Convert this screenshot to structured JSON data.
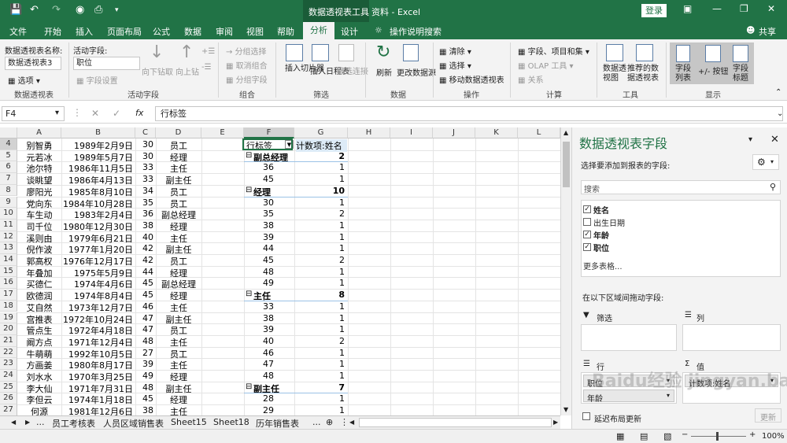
{
  "title_bar": {
    "context_title": "数据透视表工具",
    "doc_title": "资料 - Excel",
    "login": "登录"
  },
  "tabs": [
    "文件",
    "开始",
    "插入",
    "页面布局",
    "公式",
    "数据",
    "审阅",
    "视图",
    "帮助",
    "分析",
    "设计"
  ],
  "tell_me": "操作说明搜索",
  "share": "共享",
  "ribbon": {
    "pt_name_label": "数据透视表名称:",
    "pt_name_value": "数据透视表3",
    "options": "选项",
    "active_field_label": "活动字段:",
    "active_field_value": "职位",
    "field_settings": "字段设置",
    "drill_down": "向下钻取",
    "drill_up": "向上钻",
    "group_sel": "分组选择",
    "ungroup": "取消组合",
    "group_field": "分组字段",
    "insert_slicer": "插入切片器",
    "insert_timeline": "插入日程表",
    "filter_conn": "筛选连接",
    "refresh": "刷新",
    "change_source": "更改数据源",
    "clear": "清除",
    "select": "选择",
    "move_pt": "移动数据透视表",
    "fields_items": "字段、项目和集",
    "olap": "OLAP 工具",
    "relations": "关系",
    "pivot_chart": "数据透视图",
    "recommended": "推荐的数据透视表",
    "field_list": "字段列表",
    "buttons": "+/- 按钮",
    "headers": "字段标题",
    "groups": [
      "数据透视表",
      "活动字段",
      "组合",
      "筛选",
      "数据",
      "操作",
      "计算",
      "工具",
      "显示"
    ]
  },
  "formula_bar": {
    "name_box": "F4",
    "content": "行标签"
  },
  "columns": [
    "A",
    "B",
    "C",
    "D",
    "E",
    "F",
    "G",
    "H",
    "I",
    "J",
    "K",
    "L"
  ],
  "rows": [
    {
      "n": "4",
      "a": "别智勇",
      "b": "1989年2月9日",
      "c": "30",
      "d": "员工",
      "f": "行标签",
      "g": "计数项:姓名",
      "kind": "header"
    },
    {
      "n": "5",
      "a": "元若冰",
      "b": "1989年5月7日",
      "c": "30",
      "d": "经理",
      "f": "副总经理",
      "g": "2",
      "kind": "group"
    },
    {
      "n": "6",
      "a": "池尔特",
      "b": "1986年11月5日",
      "c": "33",
      "d": "主任",
      "f": "36",
      "g": "1",
      "kind": "item"
    },
    {
      "n": "7",
      "a": "谈眺望",
      "b": "1986年4月13日",
      "c": "33",
      "d": "副主任",
      "f": "45",
      "g": "1",
      "kind": "item"
    },
    {
      "n": "8",
      "a": "廖阳光",
      "b": "1985年8月10日",
      "c": "34",
      "d": "员工",
      "f": "经理",
      "g": "10",
      "kind": "group"
    },
    {
      "n": "9",
      "a": "党向东",
      "b": "1984年10月28日",
      "c": "35",
      "d": "员工",
      "f": "30",
      "g": "1",
      "kind": "item"
    },
    {
      "n": "10",
      "a": "车生动",
      "b": "1983年2月4日",
      "c": "36",
      "d": "副总经理",
      "f": "35",
      "g": "2",
      "kind": "item"
    },
    {
      "n": "11",
      "a": "司千位",
      "b": "1980年12月30日",
      "c": "38",
      "d": "经理",
      "f": "38",
      "g": "1",
      "kind": "item"
    },
    {
      "n": "12",
      "a": "溪则由",
      "b": "1979年6月21日",
      "c": "40",
      "d": "主任",
      "f": "39",
      "g": "1",
      "kind": "item"
    },
    {
      "n": "13",
      "a": "倪作波",
      "b": "1977年1月20日",
      "c": "42",
      "d": "副主任",
      "f": "44",
      "g": "1",
      "kind": "item"
    },
    {
      "n": "14",
      "a": "郭高权",
      "b": "1976年12月17日",
      "c": "42",
      "d": "员工",
      "f": "45",
      "g": "2",
      "kind": "item"
    },
    {
      "n": "15",
      "a": "年叠加",
      "b": "1975年5月9日",
      "c": "44",
      "d": "经理",
      "f": "48",
      "g": "1",
      "kind": "item"
    },
    {
      "n": "16",
      "a": "买德仁",
      "b": "1974年4月6日",
      "c": "45",
      "d": "副总经理",
      "f": "49",
      "g": "1",
      "kind": "item"
    },
    {
      "n": "17",
      "a": "欧德润",
      "b": "1974年8月4日",
      "c": "45",
      "d": "经理",
      "f": "主任",
      "g": "8",
      "kind": "group"
    },
    {
      "n": "18",
      "a": "艾自然",
      "b": "1973年12月7日",
      "c": "46",
      "d": "主任",
      "f": "33",
      "g": "1",
      "kind": "item"
    },
    {
      "n": "19",
      "a": "宫推表",
      "b": "1972年10月24日",
      "c": "47",
      "d": "副主任",
      "f": "38",
      "g": "1",
      "kind": "item"
    },
    {
      "n": "20",
      "a": "管点生",
      "b": "1972年4月18日",
      "c": "47",
      "d": "员工",
      "f": "39",
      "g": "1",
      "kind": "item"
    },
    {
      "n": "21",
      "a": "阚方点",
      "b": "1971年12月4日",
      "c": "48",
      "d": "主任",
      "f": "40",
      "g": "2",
      "kind": "item"
    },
    {
      "n": "22",
      "a": "牛萌萌",
      "b": "1992年10月5日",
      "c": "27",
      "d": "员工",
      "f": "46",
      "g": "1",
      "kind": "item"
    },
    {
      "n": "23",
      "a": "方画姜",
      "b": "1980年8月17日",
      "c": "39",
      "d": "主任",
      "f": "47",
      "g": "1",
      "kind": "item"
    },
    {
      "n": "24",
      "a": "刘水水",
      "b": "1970年3月25日",
      "c": "49",
      "d": "经理",
      "f": "48",
      "g": "1",
      "kind": "item"
    },
    {
      "n": "25",
      "a": "李大仙",
      "b": "1971年7月31日",
      "c": "48",
      "d": "副主任",
      "f": "副主任",
      "g": "7",
      "kind": "group"
    },
    {
      "n": "26",
      "a": "李但云",
      "b": "1974年1月18日",
      "c": "45",
      "d": "经理",
      "f": "28",
      "g": "1",
      "kind": "item"
    },
    {
      "n": "27",
      "a": "何源",
      "b": "1981年12月6日",
      "c": "38",
      "d": "主任",
      "f": "29",
      "g": "1",
      "kind": "item"
    }
  ],
  "sheet_tabs": [
    "员工考核表",
    "人员区域销售表",
    "Sheet15",
    "Sheet18",
    "历年销售表"
  ],
  "sheet_more": "...",
  "pane": {
    "title": "数据透视表字段",
    "subtitle": "选择要添加到报表的字段:",
    "search_placeholder": "搜索",
    "fields": [
      {
        "label": "姓名",
        "checked": true
      },
      {
        "label": "出生日期",
        "checked": false
      },
      {
        "label": "年龄",
        "checked": true
      },
      {
        "label": "职位",
        "checked": true
      }
    ],
    "more_tables": "更多表格...",
    "drag_hint": "在以下区域间拖动字段:",
    "filter_area": "筛选",
    "columns_area": "列",
    "rows_area": "行",
    "values_area": "值",
    "row_item": "职位",
    "row_item2": "年龄",
    "value_item": "计数项:姓名",
    "defer": "延迟布局更新",
    "update": "更新"
  },
  "status": {
    "zoom": "100%"
  },
  "watermark": "Baidu经验 jingyan.baidu.com"
}
